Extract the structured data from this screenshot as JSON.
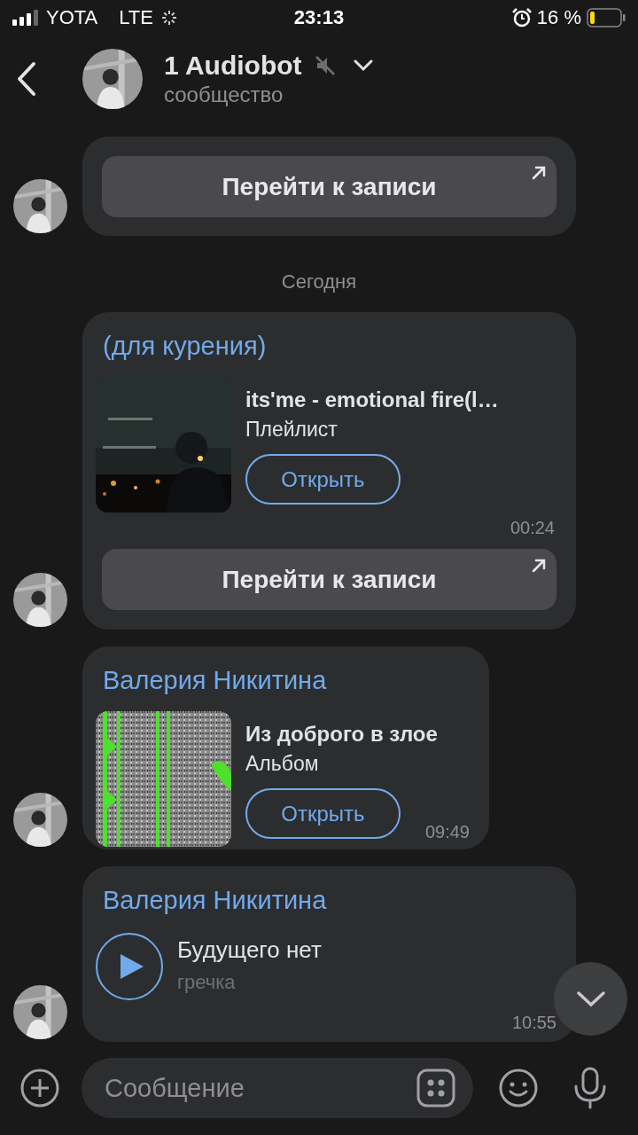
{
  "status_bar": {
    "carrier": "YOTA",
    "network": "LTE",
    "time": "23:13",
    "battery": "16 %"
  },
  "header": {
    "title": "1 Audiobot",
    "subtitle": "сообщество",
    "muted": true
  },
  "messages": [
    {
      "kind": "post_tail",
      "post_button": "Перейти к записи"
    },
    {
      "kind": "date",
      "text": "Сегодня"
    },
    {
      "kind": "playlist",
      "sender_link": "(для курения",
      "sender_rest": ")",
      "title": "its'me - emotional fire(l…",
      "subtitle": "Плейлист",
      "open_button": "Открыть",
      "time": "00:24",
      "post_button": "Перейти к записи"
    },
    {
      "kind": "album",
      "sender": "Валерия Никитина",
      "title": "Из доброго в злое",
      "subtitle": "Альбом",
      "open_button": "Открыть",
      "time": "09:49"
    },
    {
      "kind": "audio",
      "sender": "Валерия Никитина",
      "title": "Будущего нет",
      "artist": "гречка",
      "time": "10:55"
    }
  ],
  "composer": {
    "placeholder": "Сообщение"
  }
}
